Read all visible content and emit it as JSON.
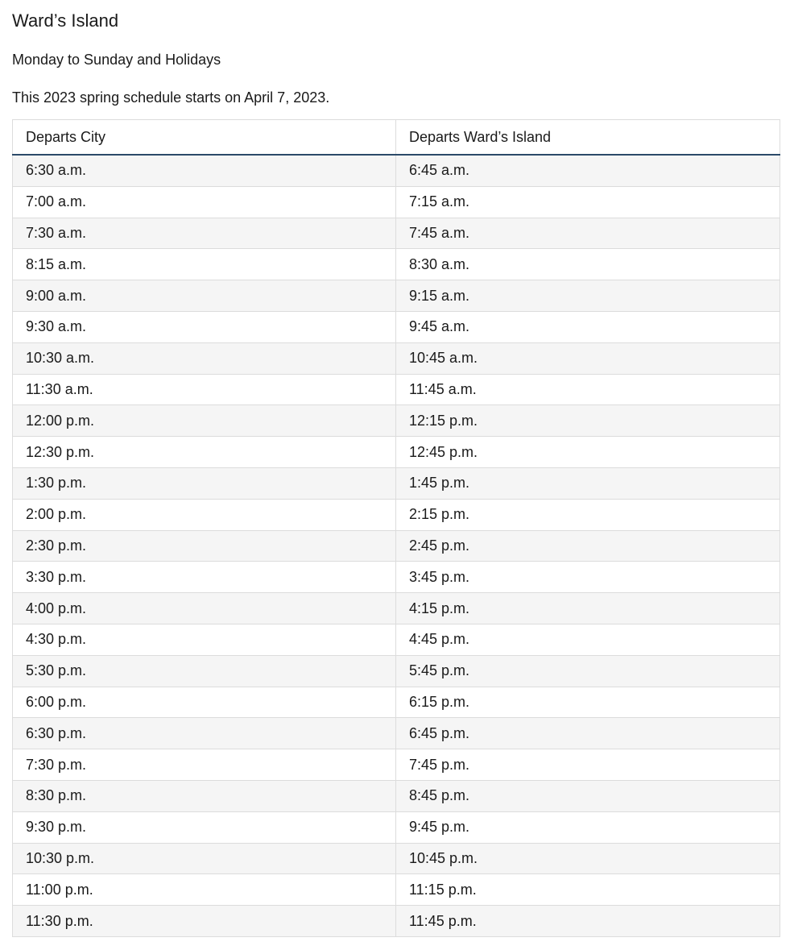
{
  "page": {
    "title": "Ward’s Island",
    "days": "Monday to Sunday and Holidays",
    "note": "This 2023 spring schedule starts on April 7, 2023."
  },
  "table": {
    "headers": [
      "Departs City",
      "Departs Ward’s Island"
    ],
    "rows": [
      [
        "6:30 a.m.",
        "6:45 a.m."
      ],
      [
        "7:00 a.m.",
        "7:15 a.m."
      ],
      [
        "7:30 a.m.",
        "7:45 a.m."
      ],
      [
        "8:15 a.m.",
        "8:30 a.m."
      ],
      [
        "9:00 a.m.",
        "9:15 a.m."
      ],
      [
        "9:30 a.m.",
        "9:45 a.m."
      ],
      [
        "10:30 a.m.",
        "10:45 a.m."
      ],
      [
        "11:30 a.m.",
        "11:45 a.m."
      ],
      [
        "12:00 p.m.",
        "12:15 p.m."
      ],
      [
        "12:30 p.m.",
        "12:45 p.m."
      ],
      [
        "1:30 p.m.",
        "1:45 p.m."
      ],
      [
        "2:00 p.m.",
        "2:15 p.m."
      ],
      [
        "2:30 p.m.",
        "2:45 p.m."
      ],
      [
        "3:30 p.m.",
        "3:45 p.m."
      ],
      [
        "4:00 p.m.",
        "4:15 p.m."
      ],
      [
        "4:30 p.m.",
        "4:45 p.m."
      ],
      [
        "5:30 p.m.",
        "5:45 p.m."
      ],
      [
        "6:00 p.m.",
        "6:15 p.m."
      ],
      [
        "6:30 p.m.",
        "6:45 p.m."
      ],
      [
        "7:30 p.m.",
        "7:45 p.m."
      ],
      [
        "8:30 p.m.",
        "8:45 p.m."
      ],
      [
        "9:30 p.m.",
        "9:45 p.m."
      ],
      [
        "10:30 p.m.",
        "10:45 p.m."
      ],
      [
        "11:00 p.m.",
        "11:15 p.m."
      ],
      [
        "11:30 p.m.",
        "11:45 p.m."
      ]
    ]
  },
  "colors": {
    "header_rule": "#2b4a69",
    "row_stripe": "#f5f5f5",
    "border": "#dcdcdc",
    "text": "#1a1a1a"
  }
}
